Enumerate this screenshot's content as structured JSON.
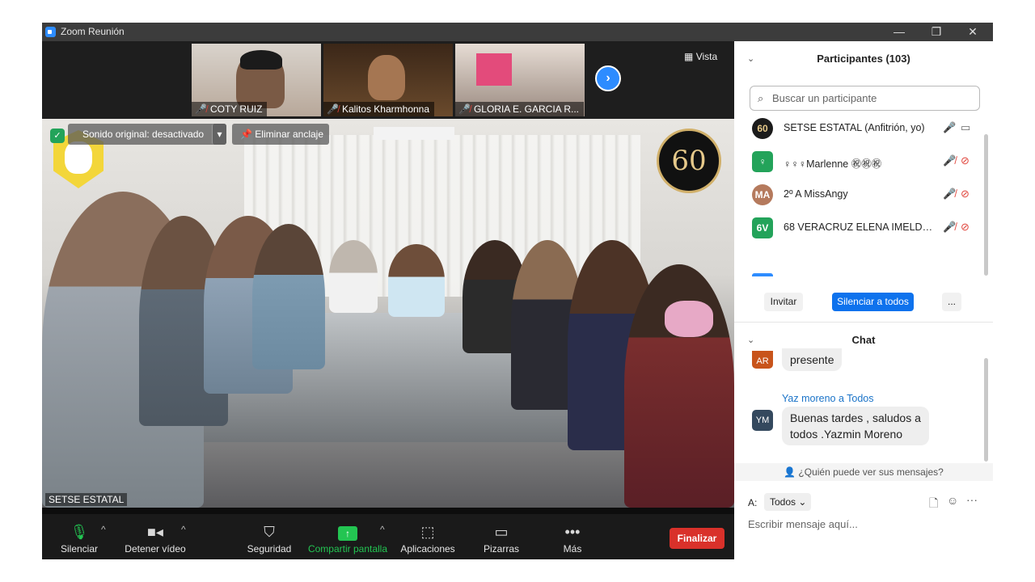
{
  "window": {
    "title": "Zoom Reunión",
    "minimize": "—",
    "restore": "❐",
    "close": "✕"
  },
  "thumbnails": [
    {
      "name": "COTY RUIZ",
      "muted": true
    },
    {
      "name": "Kalitos Kharmhonna",
      "muted": true
    },
    {
      "name": "GLORIA E. GARCIA R...",
      "muted": true
    }
  ],
  "video": {
    "view_label": "Vista",
    "original_sound": "Sonido original: desactivado",
    "unpin": "Eliminar anclaje",
    "speaker_name": "SETSE ESTATAL",
    "logo_text": "60"
  },
  "toolbar": {
    "mute": "Silenciar",
    "stop_video": "Detener vídeo",
    "security": "Seguridad",
    "share": "Compartir pantalla",
    "apps": "Aplicaciones",
    "whiteboards": "Pizarras",
    "more": "Más",
    "end": "Finalizar"
  },
  "participants": {
    "header": "Participantes (103)",
    "search_placeholder": "Buscar un participante",
    "list": [
      {
        "avatar": "60",
        "name": "SETSE ESTATAL (Anfitrión, yo)",
        "avatar_color": "#1b1b1b",
        "mic_muted": false,
        "cam_off": false
      },
      {
        "avatar": "♀",
        "name": "♀♀♀Marlenne ㊗㊗㊗",
        "avatar_color": "#23a35a",
        "mic_muted": true,
        "cam_off": true
      },
      {
        "avatar": "MA",
        "name": "2º A  MissAngy",
        "avatar_color": "#b57a5d",
        "mic_muted": true,
        "cam_off": true
      },
      {
        "avatar": "6V",
        "name": "68 VERACRUZ ELENA IMELDA ...",
        "avatar_color": "#23a35a",
        "mic_muted": true,
        "cam_off": true
      }
    ],
    "invite": "Invitar",
    "mute_all": "Silenciar a todos",
    "more": "..."
  },
  "chat": {
    "header": "Chat",
    "messages": [
      {
        "avatar": "AR",
        "avatar_color": "#c8541b",
        "sender": "",
        "text": "presente"
      },
      {
        "avatar": "YM",
        "avatar_color": "#34495e",
        "sender": "Yaz moreno a Todos",
        "text_line1": "Buenas tardes  , saludos a",
        "text_line2": "todos  .Yazmin Moreno"
      }
    ],
    "who_can_see": "¿Quién puede ver sus mensajes?",
    "to_label": "A:",
    "to_value": "Todos",
    "input_placeholder": "Escribir mensaje aquí..."
  },
  "colors": {
    "accent": "#2d8cff",
    "end": "#d9312a",
    "share": "#23c552",
    "muted": "#e0433a"
  }
}
